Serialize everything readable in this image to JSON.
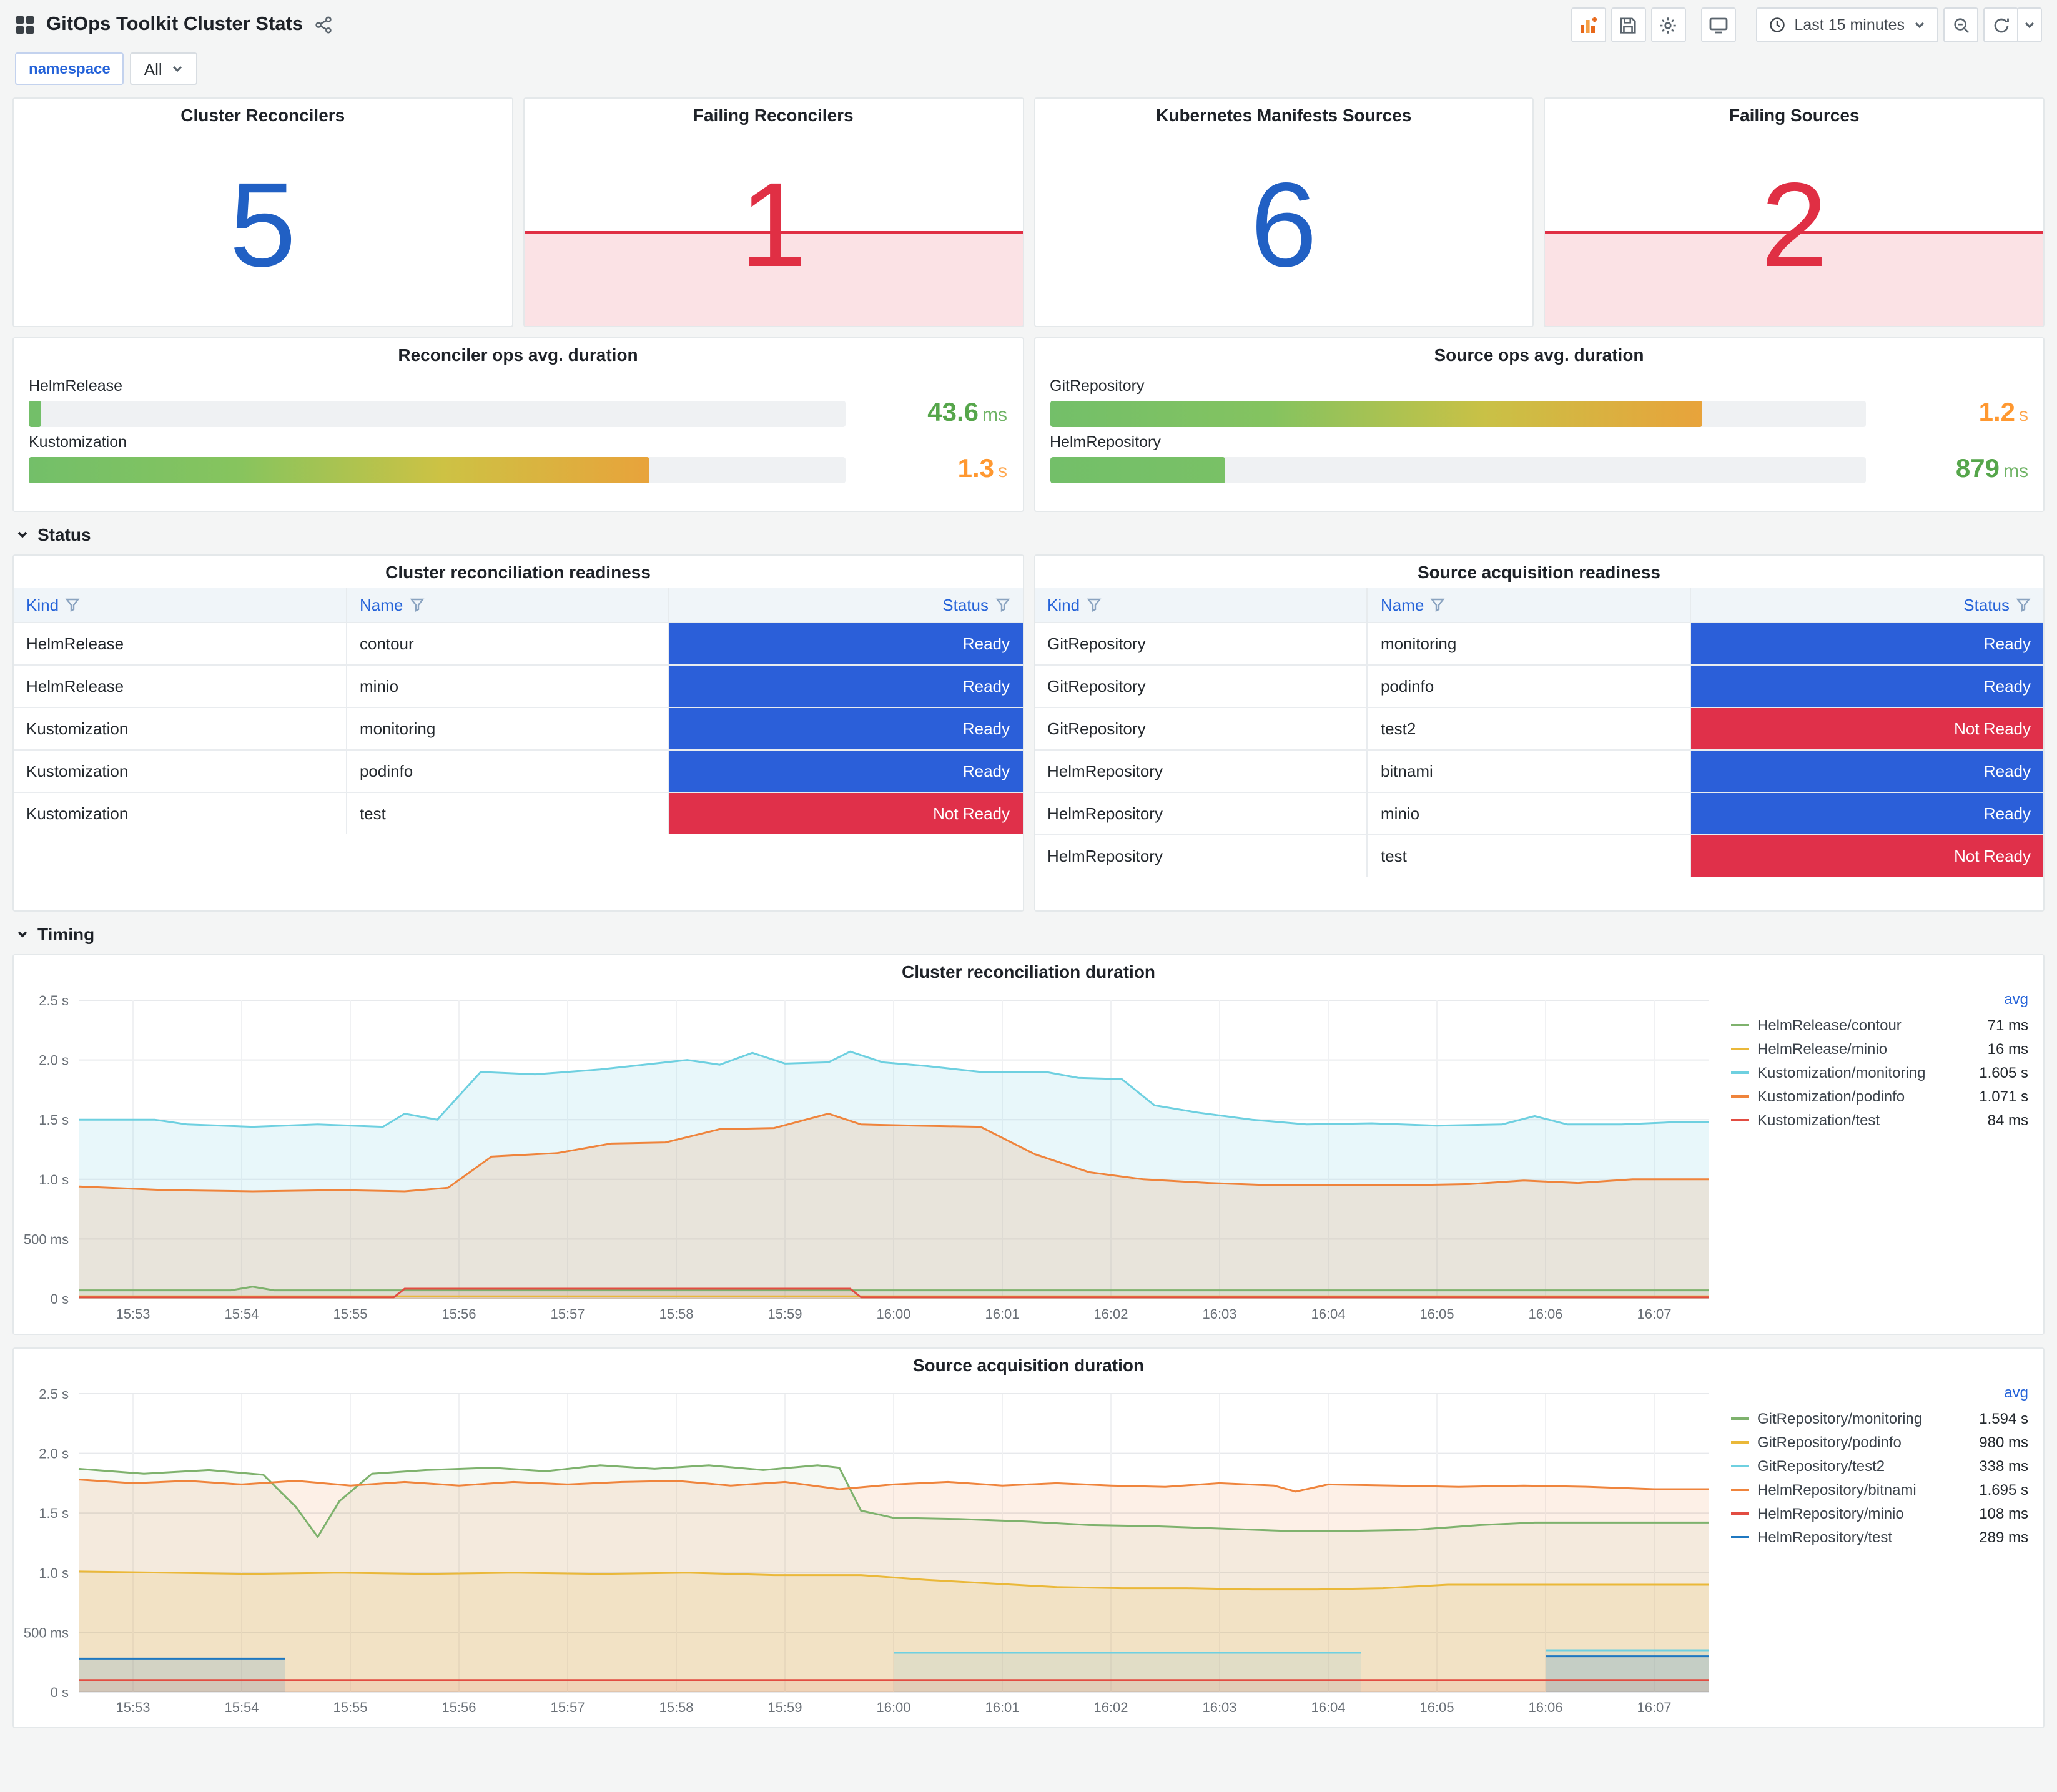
{
  "header": {
    "title": "GitOps Toolkit Cluster Stats",
    "time_range": "Last 15 minutes"
  },
  "variables": {
    "label": "namespace",
    "value": "All"
  },
  "sections": {
    "status": "Status",
    "timing": "Timing"
  },
  "stats": [
    {
      "title": "Cluster Reconcilers",
      "value": "5",
      "state": "ok"
    },
    {
      "title": "Failing Reconcilers",
      "value": "1",
      "state": "alert"
    },
    {
      "title": "Kubernetes Manifests Sources",
      "value": "6",
      "state": "ok"
    },
    {
      "title": "Failing Sources",
      "value": "2",
      "state": "alert"
    }
  ],
  "gauges": [
    {
      "title": "Reconciler ops avg. duration",
      "rows": [
        {
          "label": "HelmRelease",
          "value": "43.6",
          "unit": "ms",
          "pct": 1.6,
          "bar_stops": [
            "#73bf69",
            "#73bf69"
          ],
          "value_color": "#56a64b"
        },
        {
          "label": "Kustomization",
          "value": "1.3",
          "unit": "s",
          "pct": 76,
          "bar_stops": [
            "#73bf69",
            "#86c45e",
            "#cdc244",
            "#e8a33b"
          ],
          "value_color": "#ff9830"
        }
      ]
    },
    {
      "title": "Source ops avg. duration",
      "rows": [
        {
          "label": "GitRepository",
          "value": "1.2",
          "unit": "s",
          "pct": 80,
          "bar_stops": [
            "#73bf69",
            "#84c360",
            "#c9c146",
            "#e8a33b"
          ],
          "value_color": "#ff9830"
        },
        {
          "label": "HelmRepository",
          "value": "879",
          "unit": "ms",
          "pct": 21.5,
          "bar_stops": [
            "#73bf69",
            "#79c166"
          ],
          "value_color": "#56a64b"
        }
      ]
    }
  ],
  "tables": [
    {
      "title": "Cluster reconciliation readiness",
      "columns": [
        "Kind",
        "Name",
        "Status"
      ],
      "rows": [
        {
          "kind": "HelmRelease",
          "name": "contour",
          "status": "Ready"
        },
        {
          "kind": "HelmRelease",
          "name": "minio",
          "status": "Ready"
        },
        {
          "kind": "Kustomization",
          "name": "monitoring",
          "status": "Ready"
        },
        {
          "kind": "Kustomization",
          "name": "podinfo",
          "status": "Ready"
        },
        {
          "kind": "Kustomization",
          "name": "test",
          "status": "Not Ready"
        }
      ]
    },
    {
      "title": "Source acquisition readiness",
      "columns": [
        "Kind",
        "Name",
        "Status"
      ],
      "rows": [
        {
          "kind": "GitRepository",
          "name": "monitoring",
          "status": "Ready"
        },
        {
          "kind": "GitRepository",
          "name": "podinfo",
          "status": "Ready"
        },
        {
          "kind": "GitRepository",
          "name": "test2",
          "status": "Not Ready"
        },
        {
          "kind": "HelmRepository",
          "name": "bitnami",
          "status": "Ready"
        },
        {
          "kind": "HelmRepository",
          "name": "minio",
          "status": "Ready"
        },
        {
          "kind": "HelmRepository",
          "name": "test",
          "status": "Not Ready"
        }
      ]
    }
  ],
  "status_colors": {
    "Ready": "#2b5fd9",
    "Not Ready": "#e0304a"
  },
  "colors": {
    "ok_value": "#2160c4",
    "alert_value": "#e02f44",
    "alert_fill": "rgba(224,47,68,0.14)",
    "link_blue": "#2563d9",
    "green_value": "#56a64b",
    "orange_value": "#ff9830"
  },
  "icons": {
    "header_left": [
      "apps-icon",
      "share-icon"
    ],
    "header_right": [
      "add-panel-icon",
      "save-icon",
      "settings-icon",
      "tv-icon",
      "clock-icon",
      "chevron-down-icon",
      "zoom-out-icon",
      "refresh-icon"
    ],
    "table_header": "filter-icon",
    "section": "chevron-down-icon"
  },
  "chart_data": [
    {
      "type": "line",
      "title": "Cluster reconciliation duration",
      "legend_header": "avg",
      "ylim": [
        0,
        2.5
      ],
      "x_range": [
        0,
        15
      ],
      "x_ticks": [
        "15:53",
        "15:54",
        "15:55",
        "15:56",
        "15:57",
        "15:58",
        "15:59",
        "16:00",
        "16:01",
        "16:02",
        "16:03",
        "16:04",
        "16:05",
        "16:06",
        "16:07"
      ],
      "y_ticks": [
        {
          "v": 0,
          "label": "0 s"
        },
        {
          "v": 0.5,
          "label": "500 ms"
        },
        {
          "v": 1,
          "label": "1.0 s"
        },
        {
          "v": 1.5,
          "label": "1.5 s"
        },
        {
          "v": 2,
          "label": "2.0 s"
        },
        {
          "v": 2.5,
          "label": "2.5 s"
        }
      ],
      "series": [
        {
          "name": "HelmRelease/contour",
          "avg": "71 ms",
          "color": "#7eb26d",
          "fill_opacity": 0.1,
          "points": [
            [
              0,
              0.07
            ],
            [
              1.4,
              0.07
            ],
            [
              1.6,
              0.1
            ],
            [
              1.8,
              0.07
            ],
            [
              15,
              0.07
            ]
          ]
        },
        {
          "name": "HelmRelease/minio",
          "avg": "16 ms",
          "color": "#eab839",
          "fill_opacity": 0.1,
          "points": [
            [
              0,
              0.02
            ],
            [
              15,
              0.02
            ]
          ]
        },
        {
          "name": "Kustomization/monitoring",
          "avg": "1.605 s",
          "color": "#6ed0e0",
          "fill_opacity": 0.16,
          "points": [
            [
              0,
              1.5
            ],
            [
              0.7,
              1.5
            ],
            [
              1,
              1.46
            ],
            [
              1.6,
              1.44
            ],
            [
              2.2,
              1.46
            ],
            [
              2.8,
              1.44
            ],
            [
              3,
              1.55
            ],
            [
              3.3,
              1.5
            ],
            [
              3.7,
              1.9
            ],
            [
              4.2,
              1.88
            ],
            [
              4.8,
              1.92
            ],
            [
              5.2,
              1.96
            ],
            [
              5.6,
              2.0
            ],
            [
              5.9,
              1.96
            ],
            [
              6.2,
              2.06
            ],
            [
              6.5,
              1.97
            ],
            [
              6.9,
              1.98
            ],
            [
              7.1,
              2.07
            ],
            [
              7.4,
              1.98
            ],
            [
              7.8,
              1.95
            ],
            [
              8.3,
              1.9
            ],
            [
              8.9,
              1.9
            ],
            [
              9.2,
              1.85
            ],
            [
              9.6,
              1.84
            ],
            [
              9.9,
              1.62
            ],
            [
              10.3,
              1.56
            ],
            [
              10.8,
              1.5
            ],
            [
              11.3,
              1.46
            ],
            [
              11.9,
              1.47
            ],
            [
              12.5,
              1.45
            ],
            [
              13.1,
              1.46
            ],
            [
              13.4,
              1.53
            ],
            [
              13.7,
              1.46
            ],
            [
              14.2,
              1.46
            ],
            [
              14.7,
              1.48
            ],
            [
              15,
              1.48
            ]
          ]
        },
        {
          "name": "Kustomization/podinfo",
          "avg": "1.071 s",
          "color": "#ef843c",
          "fill_opacity": 0.16,
          "points": [
            [
              0,
              0.94
            ],
            [
              0.8,
              0.91
            ],
            [
              1.6,
              0.9
            ],
            [
              2.4,
              0.91
            ],
            [
              3,
              0.9
            ],
            [
              3.4,
              0.93
            ],
            [
              3.8,
              1.19
            ],
            [
              4.4,
              1.22
            ],
            [
              4.9,
              1.3
            ],
            [
              5.4,
              1.31
            ],
            [
              5.9,
              1.42
            ],
            [
              6.4,
              1.43
            ],
            [
              6.9,
              1.55
            ],
            [
              7.2,
              1.46
            ],
            [
              7.7,
              1.45
            ],
            [
              8.3,
              1.44
            ],
            [
              8.8,
              1.21
            ],
            [
              9.3,
              1.06
            ],
            [
              9.8,
              1.0
            ],
            [
              10.4,
              0.97
            ],
            [
              11,
              0.95
            ],
            [
              11.6,
              0.95
            ],
            [
              12.2,
              0.95
            ],
            [
              12.8,
              0.96
            ],
            [
              13.3,
              0.99
            ],
            [
              13.8,
              0.97
            ],
            [
              14.3,
              1.0
            ],
            [
              15,
              1.0
            ]
          ]
        },
        {
          "name": "Kustomization/test",
          "avg": "84 ms",
          "color": "#e24d42",
          "fill_opacity": 0.1,
          "points": [
            [
              0,
              0.012
            ],
            [
              2.9,
              0.012
            ],
            [
              3,
              0.084
            ],
            [
              7.1,
              0.084
            ],
            [
              7.2,
              0.012
            ],
            [
              15,
              0.012
            ]
          ]
        }
      ]
    },
    {
      "type": "line",
      "title": "Source acquisition duration",
      "legend_header": "avg",
      "ylim": [
        0,
        2.5
      ],
      "x_range": [
        0,
        15
      ],
      "x_ticks": [
        "15:53",
        "15:54",
        "15:55",
        "15:56",
        "15:57",
        "15:58",
        "15:59",
        "16:00",
        "16:01",
        "16:02",
        "16:03",
        "16:04",
        "16:05",
        "16:06",
        "16:07"
      ],
      "y_ticks": [
        {
          "v": 0,
          "label": "0 s"
        },
        {
          "v": 0.5,
          "label": "500 ms"
        },
        {
          "v": 1,
          "label": "1.0 s"
        },
        {
          "v": 1.5,
          "label": "1.5 s"
        },
        {
          "v": 2,
          "label": "2.0 s"
        },
        {
          "v": 2.5,
          "label": "2.5 s"
        }
      ],
      "series": [
        {
          "name": "GitRepository/monitoring",
          "avg": "1.594 s",
          "color": "#7eb26d",
          "fill_opacity": 0.08,
          "points": [
            [
              0,
              1.87
            ],
            [
              0.6,
              1.83
            ],
            [
              1.2,
              1.86
            ],
            [
              1.7,
              1.82
            ],
            [
              2,
              1.55
            ],
            [
              2.2,
              1.3
            ],
            [
              2.4,
              1.6
            ],
            [
              2.7,
              1.83
            ],
            [
              3.2,
              1.86
            ],
            [
              3.8,
              1.88
            ],
            [
              4.3,
              1.85
            ],
            [
              4.8,
              1.9
            ],
            [
              5.3,
              1.87
            ],
            [
              5.8,
              1.9
            ],
            [
              6.3,
              1.86
            ],
            [
              6.8,
              1.9
            ],
            [
              7,
              1.88
            ],
            [
              7.2,
              1.52
            ],
            [
              7.5,
              1.46
            ],
            [
              8.1,
              1.45
            ],
            [
              8.7,
              1.43
            ],
            [
              9.3,
              1.4
            ],
            [
              9.9,
              1.39
            ],
            [
              10.5,
              1.37
            ],
            [
              11.1,
              1.35
            ],
            [
              11.7,
              1.35
            ],
            [
              12.3,
              1.36
            ],
            [
              12.9,
              1.4
            ],
            [
              13.4,
              1.42
            ],
            [
              14,
              1.42
            ],
            [
              14.6,
              1.42
            ],
            [
              15,
              1.42
            ]
          ]
        },
        {
          "name": "GitRepository/podinfo",
          "avg": "980 ms",
          "color": "#eab839",
          "fill_opacity": 0.14,
          "points": [
            [
              0,
              1.01
            ],
            [
              0.8,
              1.0
            ],
            [
              1.6,
              0.99
            ],
            [
              2.4,
              1.0
            ],
            [
              3.2,
              0.99
            ],
            [
              4,
              1.0
            ],
            [
              4.8,
              0.99
            ],
            [
              5.6,
              1.0
            ],
            [
              6.4,
              0.98
            ],
            [
              7.2,
              0.98
            ],
            [
              7.8,
              0.94
            ],
            [
              8.4,
              0.91
            ],
            [
              9,
              0.88
            ],
            [
              9.6,
              0.87
            ],
            [
              10.2,
              0.87
            ],
            [
              10.8,
              0.86
            ],
            [
              11.4,
              0.86
            ],
            [
              12,
              0.87
            ],
            [
              12.6,
              0.9
            ],
            [
              13.2,
              0.9
            ],
            [
              13.8,
              0.9
            ],
            [
              14.4,
              0.9
            ],
            [
              15,
              0.9
            ]
          ]
        },
        {
          "name": "GitRepository/test2",
          "avg": "338 ms",
          "color": "#6ed0e0",
          "fill_opacity": 0.14,
          "points": [
            [
              7.5,
              0.33
            ],
            [
              11.8,
              0.33
            ],
            [
              12,
              null
            ],
            [
              13.5,
              0.35
            ],
            [
              15,
              0.35
            ]
          ]
        },
        {
          "name": "HelmRepository/bitnami",
          "avg": "1.695 s",
          "color": "#ef843c",
          "fill_opacity": 0.12,
          "points": [
            [
              0,
              1.78
            ],
            [
              0.5,
              1.75
            ],
            [
              1,
              1.77
            ],
            [
              1.5,
              1.74
            ],
            [
              2,
              1.77
            ],
            [
              2.5,
              1.73
            ],
            [
              3,
              1.76
            ],
            [
              3.5,
              1.73
            ],
            [
              4,
              1.76
            ],
            [
              4.5,
              1.74
            ],
            [
              5,
              1.76
            ],
            [
              5.5,
              1.77
            ],
            [
              6,
              1.73
            ],
            [
              6.5,
              1.76
            ],
            [
              7,
              1.7
            ],
            [
              7.5,
              1.74
            ],
            [
              8,
              1.76
            ],
            [
              8.5,
              1.73
            ],
            [
              9,
              1.75
            ],
            [
              9.5,
              1.73
            ],
            [
              10,
              1.72
            ],
            [
              10.5,
              1.75
            ],
            [
              11,
              1.73
            ],
            [
              11.2,
              1.68
            ],
            [
              11.5,
              1.74
            ],
            [
              12.1,
              1.73
            ],
            [
              12.7,
              1.72
            ],
            [
              13.3,
              1.73
            ],
            [
              13.9,
              1.72
            ],
            [
              14.5,
              1.7
            ],
            [
              15,
              1.7
            ]
          ]
        },
        {
          "name": "HelmRepository/minio",
          "avg": "108 ms",
          "color": "#e24d42",
          "fill_opacity": 0.1,
          "points": [
            [
              0,
              0.1
            ],
            [
              15,
              0.1
            ]
          ]
        },
        {
          "name": "HelmRepository/test",
          "avg": "289 ms",
          "color": "#1f78c1",
          "fill_opacity": 0.14,
          "points": [
            [
              0,
              0.28
            ],
            [
              1.9,
              0.28
            ],
            [
              2,
              null
            ],
            [
              13.5,
              0.3
            ],
            [
              15,
              0.3
            ]
          ]
        }
      ]
    }
  ]
}
